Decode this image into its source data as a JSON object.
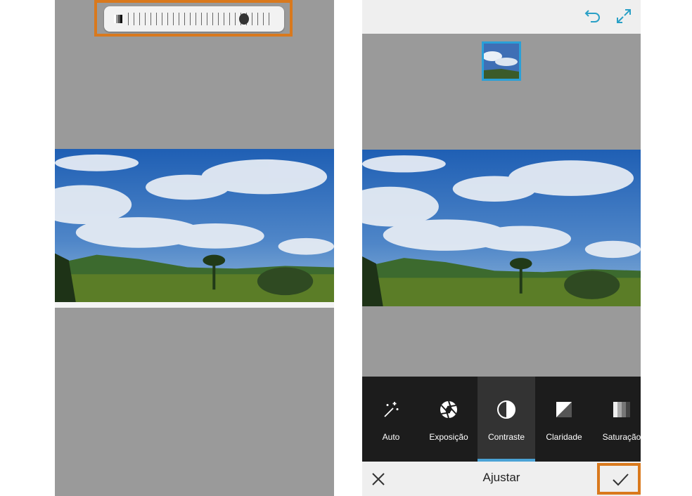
{
  "left_screen": {
    "slider": {
      "value_fraction": 0.8
    }
  },
  "right_screen": {
    "header": {
      "undo_icon": "undo-icon",
      "fullscreen_icon": "expand-icon"
    },
    "tools": [
      {
        "label": "Auto",
        "icon": "magic-wand-icon",
        "active": false
      },
      {
        "label": "Exposição",
        "icon": "aperture-icon",
        "active": false
      },
      {
        "label": "Contraste",
        "icon": "contrast-icon",
        "active": true
      },
      {
        "label": "Claridade",
        "icon": "clarity-icon",
        "active": false
      },
      {
        "label": "Saturação",
        "icon": "saturation-icon",
        "active": false
      }
    ],
    "bottom_bar": {
      "title": "Ajustar",
      "cancel_icon": "close-icon",
      "confirm_icon": "check-icon"
    }
  },
  "colors": {
    "highlight": "#d9791d",
    "accent": "#2aa0c6",
    "toolbar_bg": "#1c1c1c"
  }
}
